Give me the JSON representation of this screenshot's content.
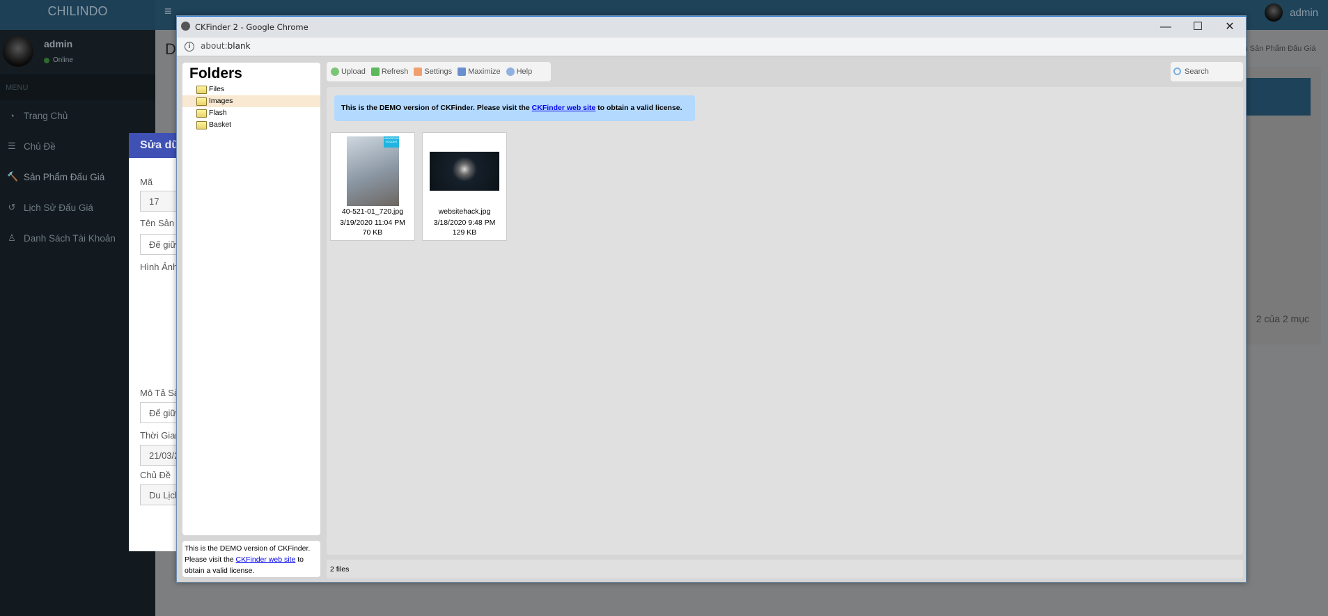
{
  "app": {
    "brand": "CHILINDO",
    "user": "admin",
    "status": "Online",
    "menu_header": "MENU",
    "menu": [
      {
        "label": "Trang Chủ",
        "icon": "dashboard-icon"
      },
      {
        "label": "Chủ Đề",
        "icon": "list-icon"
      },
      {
        "label": "Sản Phẩm Đấu Giá",
        "icon": "gavel-icon"
      },
      {
        "label": "Lịch Sử Đấu Giá",
        "icon": "history-icon"
      },
      {
        "label": "Danh Sách Tài Khoản",
        "icon": "user-icon"
      }
    ],
    "page_title": "D",
    "breadcrumb": "ch Sản Phẩm Đấu Giá",
    "pagination": "2 của 2 mục"
  },
  "modal": {
    "title": "Sửa dữ l",
    "fields": [
      {
        "label": "Mã",
        "value": "17"
      },
      {
        "label": "Tên Sản P",
        "value": "Đế giữ"
      },
      {
        "label": "Hình Ảnh",
        "value": ""
      },
      {
        "label": "Mô Tả Sả",
        "value": "Để giữ"
      },
      {
        "label": "Thời Gian",
        "value": "21/03/2"
      },
      {
        "label": "Chủ Đề",
        "value": "Du Lịch"
      }
    ]
  },
  "chrome": {
    "title": "CKFinder 2 - Google Chrome",
    "url_scheme": "about:",
    "url_rest": "blank",
    "minimize": "—",
    "maximize": "☐",
    "close": "✕"
  },
  "ckfinder": {
    "folders_title": "Folders",
    "folders": [
      {
        "name": "Files",
        "selected": false
      },
      {
        "name": "Images",
        "selected": true
      },
      {
        "name": "Flash",
        "selected": false
      },
      {
        "name": "Basket",
        "selected": false
      }
    ],
    "toolbar": {
      "upload": "Upload",
      "refresh": "Refresh",
      "settings": "Settings",
      "maximize": "Maximize",
      "help": "Help"
    },
    "search_placeholder": "Search",
    "demo": {
      "pre": "This is the DEMO version of CKFinder. Please visit the ",
      "link": "CKFinder web site",
      "post": " to obtain a valid license."
    },
    "files": [
      {
        "name": "40-521-01_720.jpg",
        "date": "3/19/2020 11:04 PM",
        "size": "70 KB",
        "thumb_text": "UNIVERSAL HOLDER"
      },
      {
        "name": "websitehack.jpg",
        "date": "3/18/2020 9:48 PM",
        "size": "129 KB"
      }
    ],
    "status": "2 files"
  }
}
